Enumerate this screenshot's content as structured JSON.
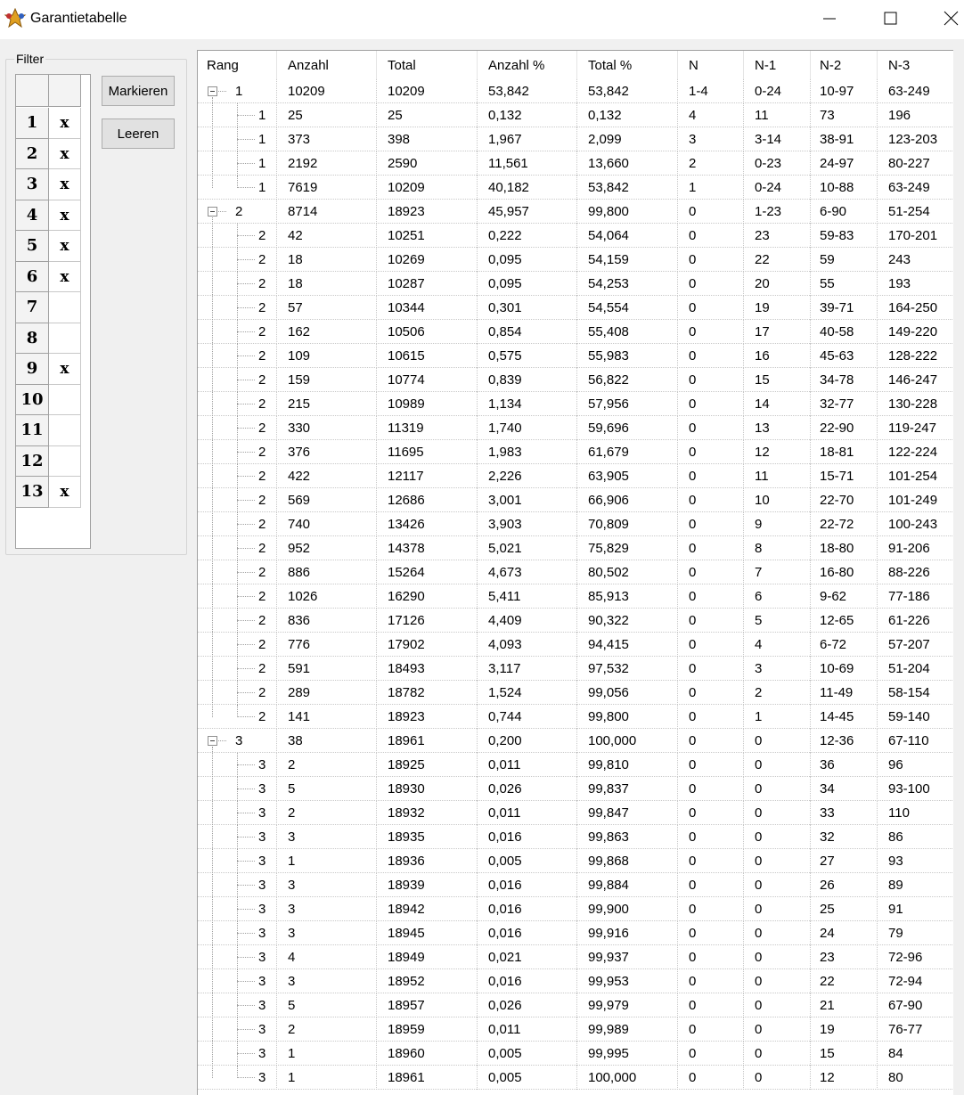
{
  "window": {
    "title": "Garantietabelle",
    "icon": "app-star-icon",
    "controls": [
      "minimize-icon",
      "maximize-icon",
      "close-icon"
    ]
  },
  "filter": {
    "legend": "Filter",
    "rows": [
      {
        "num": "1",
        "mark": "x"
      },
      {
        "num": "2",
        "mark": "x"
      },
      {
        "num": "3",
        "mark": "x"
      },
      {
        "num": "4",
        "mark": "x"
      },
      {
        "num": "5",
        "mark": "x"
      },
      {
        "num": "6",
        "mark": "x"
      },
      {
        "num": "7",
        "mark": ""
      },
      {
        "num": "8",
        "mark": ""
      },
      {
        "num": "9",
        "mark": "x"
      },
      {
        "num": "10",
        "mark": ""
      },
      {
        "num": "11",
        "mark": ""
      },
      {
        "num": "12",
        "mark": ""
      },
      {
        "num": "13",
        "mark": "x"
      }
    ],
    "buttons": {
      "mark": "Markieren",
      "clear": "Leeren"
    }
  },
  "table": {
    "columns": [
      "Rang",
      "Anzahl",
      "Total",
      "Anzahl %",
      "Total %",
      "N",
      "N-1",
      "N-2",
      "N-3"
    ],
    "rows": [
      [
        "p",
        "1",
        "10209",
        "10209",
        "53,842",
        "53,842",
        "1-4",
        "0-24",
        "10-97",
        "63-249"
      ],
      [
        "c",
        "1",
        "25",
        "25",
        "0,132",
        "0,132",
        "4",
        "11",
        "73",
        "196"
      ],
      [
        "c",
        "1",
        "373",
        "398",
        "1,967",
        "2,099",
        "3",
        "3-14",
        "38-91",
        "123-203"
      ],
      [
        "c",
        "1",
        "2192",
        "2590",
        "11,561",
        "13,660",
        "2",
        "0-23",
        "24-97",
        "80-227"
      ],
      [
        "l",
        "1",
        "7619",
        "10209",
        "40,182",
        "53,842",
        "1",
        "0-24",
        "10-88",
        "63-249"
      ],
      [
        "p",
        "2",
        "8714",
        "18923",
        "45,957",
        "99,800",
        "0",
        "1-23",
        "6-90",
        "51-254"
      ],
      [
        "c",
        "2",
        "42",
        "10251",
        "0,222",
        "54,064",
        "0",
        "23",
        "59-83",
        "170-201"
      ],
      [
        "c",
        "2",
        "18",
        "10269",
        "0,095",
        "54,159",
        "0",
        "22",
        "59",
        "243"
      ],
      [
        "c",
        "2",
        "18",
        "10287",
        "0,095",
        "54,253",
        "0",
        "20",
        "55",
        "193"
      ],
      [
        "c",
        "2",
        "57",
        "10344",
        "0,301",
        "54,554",
        "0",
        "19",
        "39-71",
        "164-250"
      ],
      [
        "c",
        "2",
        "162",
        "10506",
        "0,854",
        "55,408",
        "0",
        "17",
        "40-58",
        "149-220"
      ],
      [
        "c",
        "2",
        "109",
        "10615",
        "0,575",
        "55,983",
        "0",
        "16",
        "45-63",
        "128-222"
      ],
      [
        "c",
        "2",
        "159",
        "10774",
        "0,839",
        "56,822",
        "0",
        "15",
        "34-78",
        "146-247"
      ],
      [
        "c",
        "2",
        "215",
        "10989",
        "1,134",
        "57,956",
        "0",
        "14",
        "32-77",
        "130-228"
      ],
      [
        "c",
        "2",
        "330",
        "11319",
        "1,740",
        "59,696",
        "0",
        "13",
        "22-90",
        "119-247"
      ],
      [
        "c",
        "2",
        "376",
        "11695",
        "1,983",
        "61,679",
        "0",
        "12",
        "18-81",
        "122-224"
      ],
      [
        "c",
        "2",
        "422",
        "12117",
        "2,226",
        "63,905",
        "0",
        "11",
        "15-71",
        "101-254"
      ],
      [
        "c",
        "2",
        "569",
        "12686",
        "3,001",
        "66,906",
        "0",
        "10",
        "22-70",
        "101-249"
      ],
      [
        "c",
        "2",
        "740",
        "13426",
        "3,903",
        "70,809",
        "0",
        "9",
        "22-72",
        "100-243"
      ],
      [
        "c",
        "2",
        "952",
        "14378",
        "5,021",
        "75,829",
        "0",
        "8",
        "18-80",
        "91-206"
      ],
      [
        "c",
        "2",
        "886",
        "15264",
        "4,673",
        "80,502",
        "0",
        "7",
        "16-80",
        "88-226"
      ],
      [
        "c",
        "2",
        "1026",
        "16290",
        "5,411",
        "85,913",
        "0",
        "6",
        "9-62",
        "77-186"
      ],
      [
        "c",
        "2",
        "836",
        "17126",
        "4,409",
        "90,322",
        "0",
        "5",
        "12-65",
        "61-226"
      ],
      [
        "c",
        "2",
        "776",
        "17902",
        "4,093",
        "94,415",
        "0",
        "4",
        "6-72",
        "57-207"
      ],
      [
        "c",
        "2",
        "591",
        "18493",
        "3,117",
        "97,532",
        "0",
        "3",
        "10-69",
        "51-204"
      ],
      [
        "c",
        "2",
        "289",
        "18782",
        "1,524",
        "99,056",
        "0",
        "2",
        "11-49",
        "58-154"
      ],
      [
        "l",
        "2",
        "141",
        "18923",
        "0,744",
        "99,800",
        "0",
        "1",
        "14-45",
        "59-140"
      ],
      [
        "p",
        "3",
        "38",
        "18961",
        "0,200",
        "100,000",
        "0",
        "0",
        "12-36",
        "67-110"
      ],
      [
        "c",
        "3",
        "2",
        "18925",
        "0,011",
        "99,810",
        "0",
        "0",
        "36",
        "96"
      ],
      [
        "c",
        "3",
        "5",
        "18930",
        "0,026",
        "99,837",
        "0",
        "0",
        "34",
        "93-100"
      ],
      [
        "c",
        "3",
        "2",
        "18932",
        "0,011",
        "99,847",
        "0",
        "0",
        "33",
        "110"
      ],
      [
        "c",
        "3",
        "3",
        "18935",
        "0,016",
        "99,863",
        "0",
        "0",
        "32",
        "86"
      ],
      [
        "c",
        "3",
        "1",
        "18936",
        "0,005",
        "99,868",
        "0",
        "0",
        "27",
        "93"
      ],
      [
        "c",
        "3",
        "3",
        "18939",
        "0,016",
        "99,884",
        "0",
        "0",
        "26",
        "89"
      ],
      [
        "c",
        "3",
        "3",
        "18942",
        "0,016",
        "99,900",
        "0",
        "0",
        "25",
        "91"
      ],
      [
        "c",
        "3",
        "3",
        "18945",
        "0,016",
        "99,916",
        "0",
        "0",
        "24",
        "79"
      ],
      [
        "c",
        "3",
        "4",
        "18949",
        "0,021",
        "99,937",
        "0",
        "0",
        "23",
        "72-96"
      ],
      [
        "c",
        "3",
        "3",
        "18952",
        "0,016",
        "99,953",
        "0",
        "0",
        "22",
        "72-94"
      ],
      [
        "c",
        "3",
        "5",
        "18957",
        "0,026",
        "99,979",
        "0",
        "0",
        "21",
        "67-90"
      ],
      [
        "c",
        "3",
        "2",
        "18959",
        "0,011",
        "99,989",
        "0",
        "0",
        "19",
        "76-77"
      ],
      [
        "c",
        "3",
        "1",
        "18960",
        "0,005",
        "99,995",
        "0",
        "0",
        "15",
        "84"
      ],
      [
        "l",
        "3",
        "1",
        "18961",
        "0,005",
        "100,000",
        "0",
        "0",
        "12",
        "80"
      ]
    ]
  }
}
